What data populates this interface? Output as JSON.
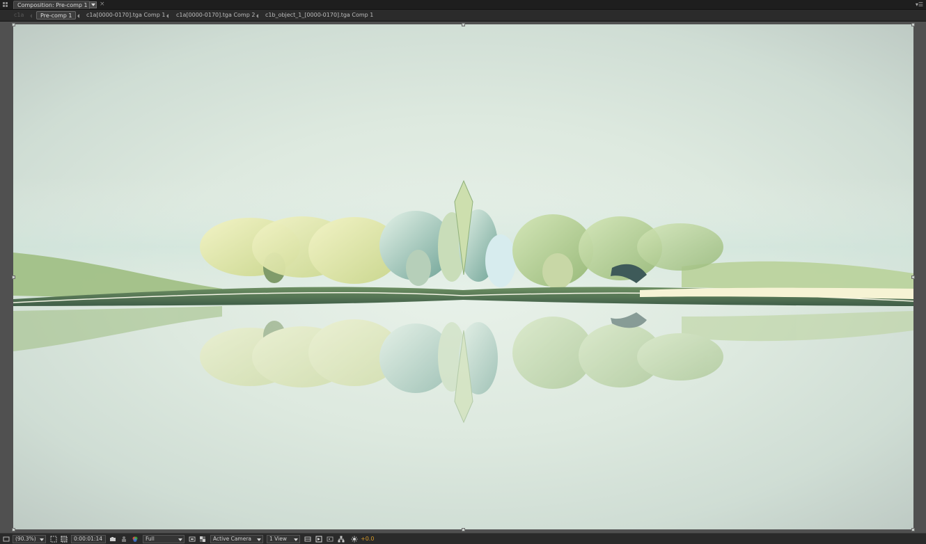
{
  "panel": {
    "tab_label": "Composition: Pre-comp 1",
    "close_glyph": "×",
    "flyout_glyph": "▾☰"
  },
  "flow": {
    "crumbs": [
      {
        "label": "c1a"
      },
      {
        "label": "Pre-comp 1"
      },
      {
        "label": "c1a[0000-0170].tga Comp 1"
      },
      {
        "label": "c1a[0000-0170].tga Comp 2"
      },
      {
        "label": "c1b_object_1_[0000-0170].tga Comp 1"
      }
    ]
  },
  "toolbar": {
    "magnification": "(90.3%)",
    "timecode": "0:00:01:14",
    "resolution": "Full",
    "camera": "Active Camera",
    "view_layout": "1 View",
    "exposure": "+0.0"
  },
  "icons": {
    "panel_grip": "panel-grip-icon",
    "always_preview": "monitor-icon",
    "grid_guides": "grid-options-icon",
    "mask_visibility": "mask-toggle-icon",
    "snapshot": "camera-icon",
    "show_snapshot": "person-icon",
    "channels": "rgb-channels-icon",
    "region_of_interest": "roi-icon",
    "transparency_grid": "checkerboard-icon",
    "timeline": "timeline-icon",
    "fast_previews": "fast-previews-icon",
    "flowchart": "flowchart-icon",
    "reset_exposure": "exposure-icon"
  },
  "colors": {
    "panel_bg": "#232323",
    "viewer_bg": "#505050",
    "exposure_text": "#d79a28"
  }
}
